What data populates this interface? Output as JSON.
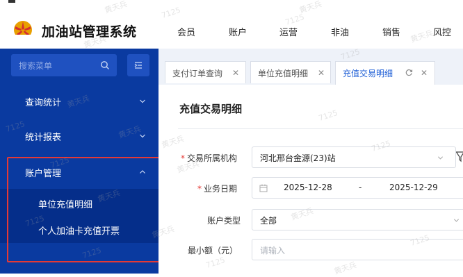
{
  "app": {
    "title": "加油站管理系统"
  },
  "topnav": [
    "会员",
    "账户",
    "运营",
    "非油",
    "销售",
    "风控"
  ],
  "sidebar": {
    "search_placeholder": "搜索菜单",
    "groups": [
      {
        "label": "查询统计",
        "expanded": false
      },
      {
        "label": "统计报表",
        "expanded": false
      },
      {
        "label": "账户管理",
        "expanded": true,
        "items": [
          "单位充值明细",
          "个人加油卡充值开票"
        ]
      }
    ]
  },
  "tabs": [
    {
      "label": "支付订单查询",
      "active": false
    },
    {
      "label": "单位充值明细",
      "active": false
    },
    {
      "label": "充值交易明细",
      "active": true
    }
  ],
  "page": {
    "title": "充值交易明细",
    "fields": {
      "org": {
        "label": "交易所属机构",
        "required": true,
        "value": "河北邢台金源(23)站"
      },
      "date": {
        "label": "业务日期",
        "required": true,
        "start": "2025-12-28",
        "separator": "-",
        "end": "2025-12-29"
      },
      "account_type": {
        "label": "账户类型",
        "required": false,
        "value": "全部"
      },
      "min_amount": {
        "label": "最小额（元）",
        "required": false,
        "placeholder": "请输入"
      }
    }
  },
  "watermark": {
    "name": "黄天兵",
    "code": "7125"
  },
  "colors": {
    "sidebar_bg": "#0a3aa0",
    "accent": "#1f5fd6",
    "highlight": "#e53935"
  }
}
